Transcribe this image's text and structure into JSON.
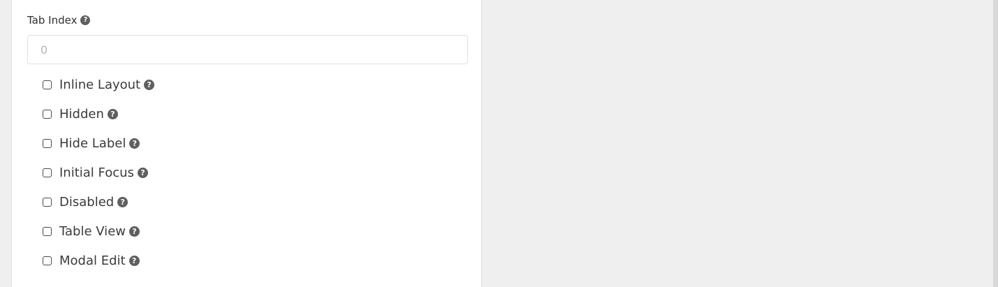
{
  "field": {
    "label": "Tab Index",
    "help_icon": "question-circle-icon",
    "input_placeholder": "0",
    "input_value": ""
  },
  "options": [
    {
      "label": "Inline Layout",
      "checked": false,
      "help_icon": "question-circle-icon"
    },
    {
      "label": "Hidden",
      "checked": false,
      "help_icon": "question-circle-icon"
    },
    {
      "label": "Hide Label",
      "checked": false,
      "help_icon": "question-circle-icon"
    },
    {
      "label": "Initial Focus",
      "checked": false,
      "help_icon": "question-circle-icon"
    },
    {
      "label": "Disabled",
      "checked": false,
      "help_icon": "question-circle-icon"
    },
    {
      "label": "Table View",
      "checked": false,
      "help_icon": "question-circle-icon"
    },
    {
      "label": "Modal Edit",
      "checked": false,
      "help_icon": "question-circle-icon"
    }
  ],
  "help_glyph": "?",
  "colors": {
    "panel_bg": "#ffffff",
    "page_bg": "#efefef",
    "icon_bg": "#5f5f5f",
    "text": "#3b3b3b"
  }
}
